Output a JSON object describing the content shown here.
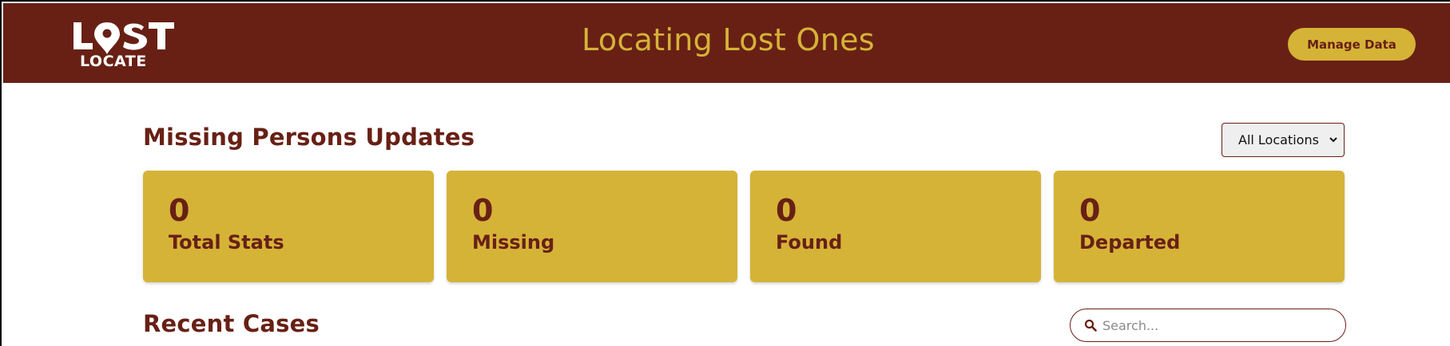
{
  "header": {
    "logo_top": "LOST",
    "logo_bottom": "LOCATE",
    "title": "Locating Lost Ones",
    "manage_button": "Manage Data"
  },
  "updates": {
    "title": "Missing Persons Updates",
    "location_filter": {
      "selected": "All Locations"
    },
    "stats": [
      {
        "value": "0",
        "label": "Total Stats"
      },
      {
        "value": "0",
        "label": "Missing"
      },
      {
        "value": "0",
        "label": "Found"
      },
      {
        "value": "0",
        "label": "Departed"
      }
    ]
  },
  "recent": {
    "title": "Recent Cases",
    "search_placeholder": "Search..."
  },
  "colors": {
    "brand_maroon": "#682015",
    "brand_gold": "#d5b337"
  },
  "icons": {
    "logo_pin": "location-pin-icon",
    "search": "search-icon",
    "dropdown": "chevron-down-icon"
  }
}
